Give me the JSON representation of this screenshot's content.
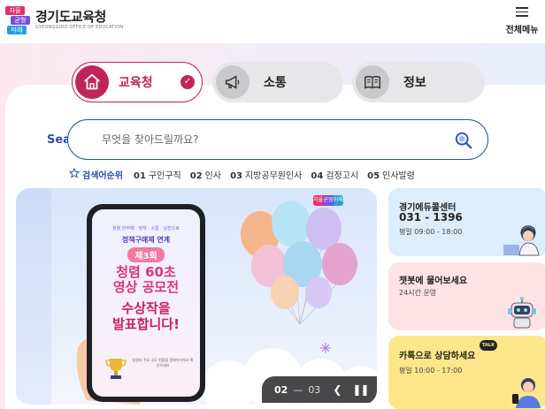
{
  "header": {
    "logo_marks": [
      "자율",
      "균형",
      "미래"
    ],
    "title": "경기도교육청",
    "subtitle": "GYEONGGIDO OFFICE OF EDUCATION",
    "menu_label": "전체메뉴"
  },
  "tabs": [
    {
      "label": "교육청",
      "icon": "home-icon",
      "selected": true
    },
    {
      "label": "소통",
      "icon": "megaphone-icon",
      "selected": false
    },
    {
      "label": "정보",
      "icon": "book-icon",
      "selected": false
    }
  ],
  "search": {
    "label": "Search",
    "placeholder": "무엇을 찾아드릴까요?"
  },
  "ranking": {
    "title": "검색어순위",
    "items": [
      {
        "rank": "01",
        "term": "구인구직"
      },
      {
        "rank": "02",
        "term": "인사"
      },
      {
        "rank": "03",
        "term": "지방공무원인사"
      },
      {
        "rank": "04",
        "term": "검정고시"
      },
      {
        "rank": "05",
        "term": "인사발령"
      }
    ]
  },
  "banner": {
    "badge": [
      "자율",
      "균형",
      "미래"
    ],
    "top_small": "청렴 반부패 · 정책 · 소통 · 실천으로",
    "line1": "정책구매제 연계",
    "line2": "제3회",
    "line3": "청렴 60초",
    "line4": "영상 공모전",
    "line5": "수상작을",
    "line6": "발표합니다!",
    "footnote": "청렴과 주요 공모 현황을 홈페이지에서 확인하세요",
    "current": "02",
    "separator": "—",
    "total": "03",
    "prev_label": "❮",
    "pause_label": "❚❚",
    "next_label": "❯"
  },
  "cards": {
    "center": {
      "title": "경기에듀콜센터",
      "phone": "031 - 1396",
      "hours": "평일 09:00 - 18:00"
    },
    "chatbot": {
      "title": "챗봇에 물어보세요",
      "hours": "24시간 운영"
    },
    "kakao": {
      "title": "카톡으로 상담하세요",
      "bubble": "TALK",
      "hours": "평일 10:00 - 17:00"
    }
  },
  "colors": {
    "accent": "#c0245a",
    "search_blue": "#2a4fb0",
    "card_blue": "#dcedfb",
    "card_pink": "#fde3e6",
    "card_yellow": "#fde78a"
  }
}
